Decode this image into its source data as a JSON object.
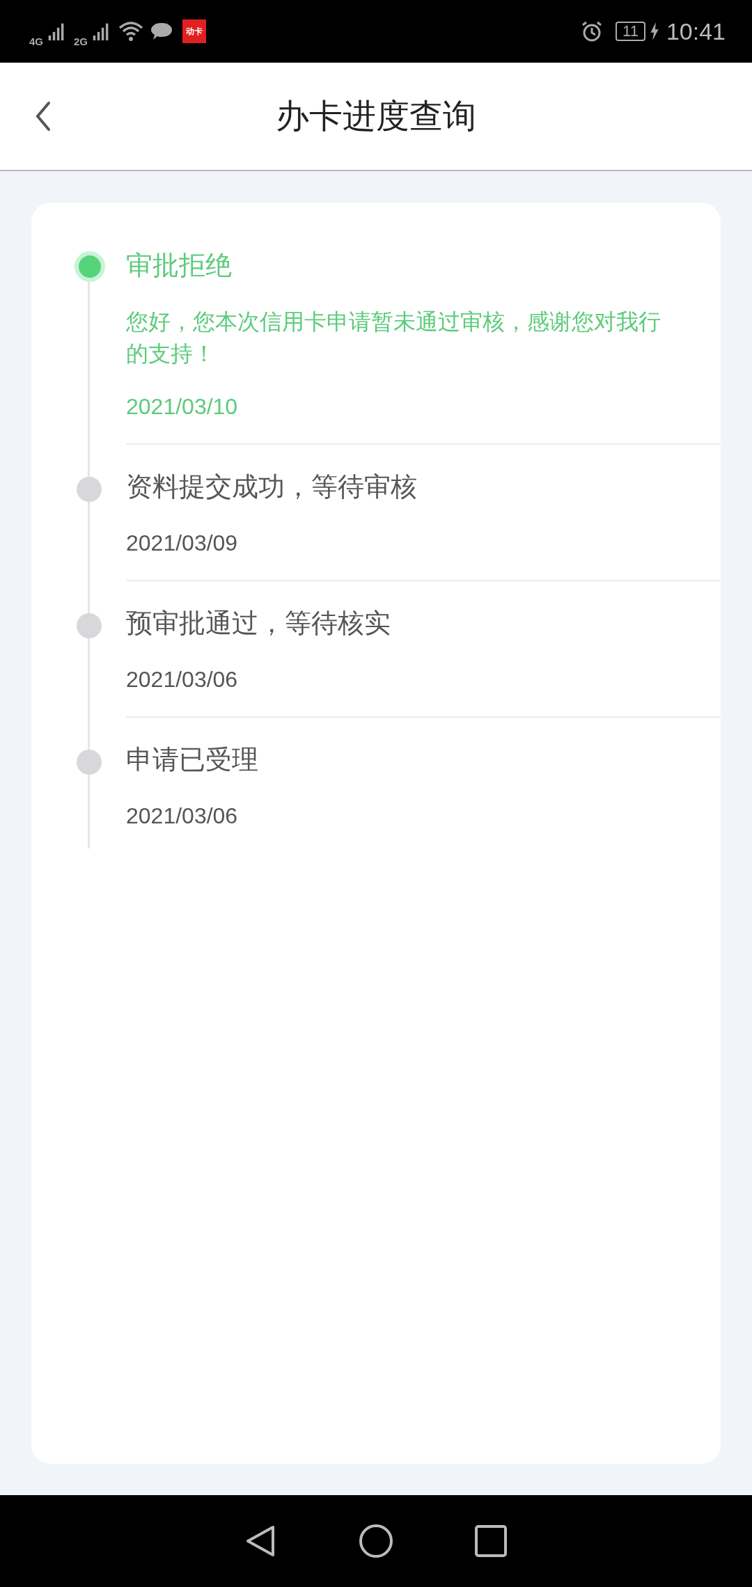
{
  "status_bar": {
    "network_1": "4G",
    "network_2": "2G",
    "app_badge": "动卡",
    "battery": "11",
    "time": "10:41"
  },
  "header": {
    "title": "办卡进度查询"
  },
  "timeline": [
    {
      "title": "审批拒绝",
      "description": "您好，您本次信用卡申请暂未通过审核，感谢您对我行的支持！",
      "date": "2021/03/10",
      "active": true
    },
    {
      "title": "资料提交成功，等待审核",
      "date": "2021/03/09",
      "active": false
    },
    {
      "title": "预审批通过，等待核实",
      "date": "2021/03/06",
      "active": false
    },
    {
      "title": "申请已受理",
      "date": "2021/03/06",
      "active": false
    }
  ]
}
